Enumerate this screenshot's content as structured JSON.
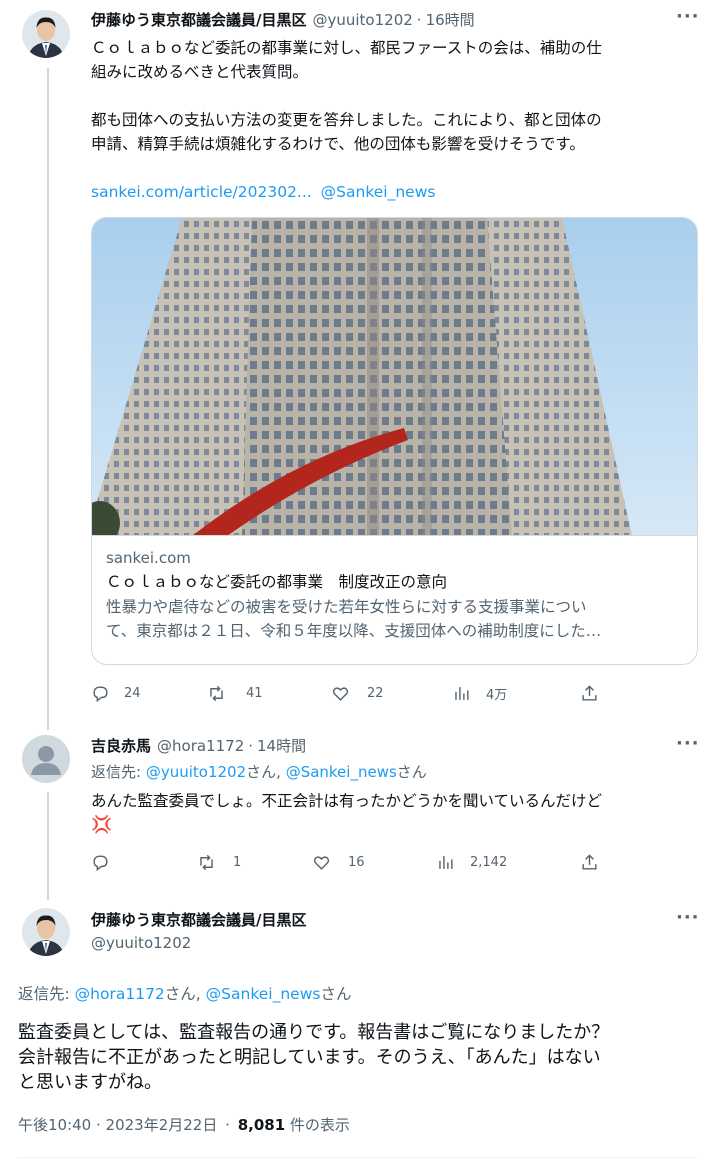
{
  "tweet1": {
    "name": "伊藤ゆう東京都議会議員/目黒区",
    "handle": "@yuuito1202",
    "time": "16時間",
    "text_lines": [
      "Ｃｏｌａｂｏなど委託の都事業に対し、都民ファーストの会は、補助の仕",
      "組みに改めるべきと代表質問。",
      "",
      "都も団体への支払い方法の変更を答弁しました。これにより、都と団体の",
      "申請、精算手続は煩雑化するわけで、他の団体も影響を受けそうです。"
    ],
    "link_text": "sankei.com/article/202302...",
    "mention": "@Sankei_news",
    "card": {
      "domain": "sankei.com",
      "title": "Ｃｏｌａｂｏなど委託の都事業　制度改正の意向",
      "desc_lines": [
        "性暴力や虐待などの被害を受けた若年女性らに対する支援事業につい",
        "て、東京都は２１日、令和５年度以降、支援団体への補助制度にした…"
      ]
    },
    "actions": {
      "replies": "24",
      "retweets": "41",
      "likes": "22",
      "views": "4万"
    }
  },
  "tweet2": {
    "name": "吉良赤馬",
    "handle": "@hora1172",
    "time": "14時間",
    "reply_to_label": "返信先:",
    "reply_to_1": "@yuuito1202",
    "reply_to_sep": "さん, ",
    "reply_to_2": "@Sankei_news",
    "reply_to_end": "さん",
    "text": "あんた監査委員でしょ。不正会計は有ったかどうかを聞いているんだけど",
    "emoji": "💢",
    "actions": {
      "replies": "",
      "retweets": "1",
      "likes": "16",
      "views": "2,142"
    }
  },
  "tweet3": {
    "name": "伊藤ゆう東京都議会議員/目黒区",
    "handle": "@yuuito1202",
    "reply_to_label": "返信先:",
    "reply_to_1": "@hora1172",
    "reply_to_sep": "さん, ",
    "reply_to_2": "@Sankei_news",
    "reply_to_end": "さん",
    "text_lines": [
      "監査委員としては、監査報告の通りです。報告書はご覧になりましたか？",
      "会計報告に不正があったと明記しています。そのうえ、「あんた」はない",
      "と思いますがね。"
    ],
    "time": "午後10:40 · 2023年2月22日",
    "view_count": "8,081",
    "view_label": "件の表示"
  },
  "icons": [
    "reply-icon",
    "retweet-icon",
    "like-icon",
    "views-icon",
    "share-icon",
    "more-icon",
    "anger-emoji"
  ]
}
